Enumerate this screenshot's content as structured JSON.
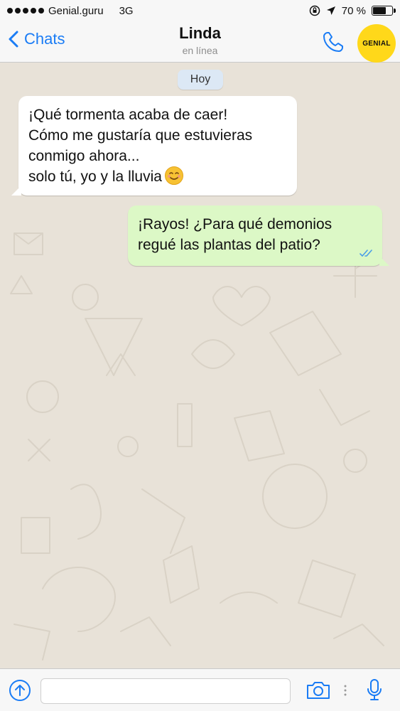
{
  "status_bar": {
    "carrier": "Genial.guru",
    "network": "3G",
    "battery_text": "70 %",
    "battery_level": 0.7
  },
  "header": {
    "back_label": "Chats",
    "contact_name": "Linda",
    "contact_status": "en línea",
    "logo_text": "GENIAL",
    "accent_color": "#1a7cf5",
    "logo_color": "#ffd81a"
  },
  "chat": {
    "date_label": "Hoy",
    "messages": [
      {
        "direction": "incoming",
        "lines": [
          "¡Qué tormenta acaba de caer!",
          "Cómo me gustaría que estuvieras",
          "conmigo ahora...",
          "solo tú, yo y la lluvia"
        ],
        "emoji": "smiling-face"
      },
      {
        "direction": "outgoing",
        "lines": [
          "¡Rayos! ¿Para qué demonios",
          "regué las plantas del patio?"
        ],
        "status": "read",
        "bubble_color": "#dcf8c6"
      }
    ]
  },
  "input_bar": {
    "text_value": "",
    "icons": [
      "attach-icon",
      "camera-icon",
      "microphone-icon"
    ]
  }
}
